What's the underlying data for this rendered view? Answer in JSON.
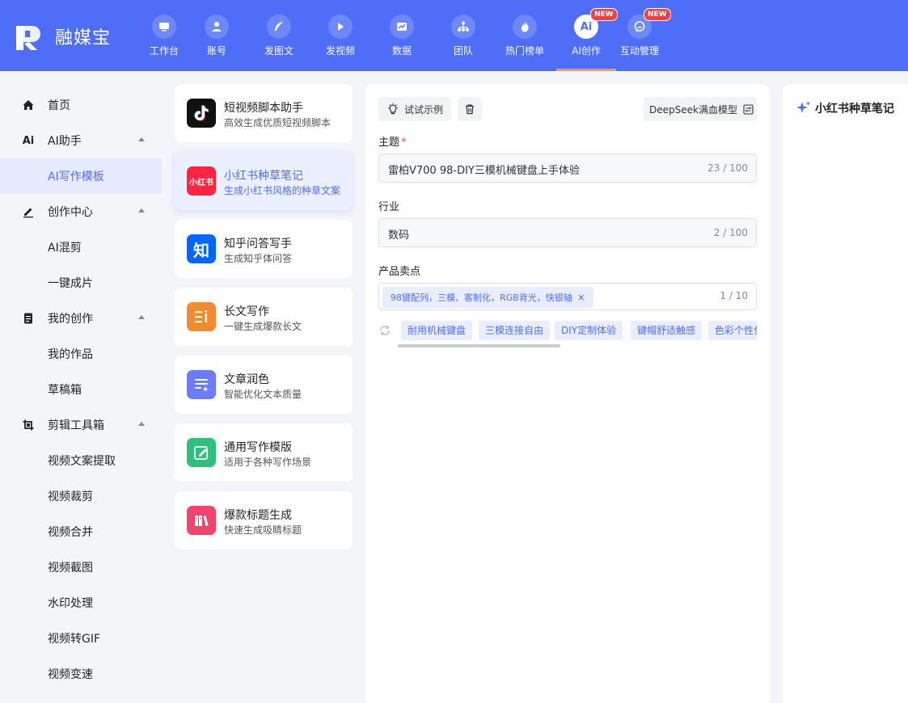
{
  "app": {
    "brand": "融媒宝"
  },
  "nav": {
    "items": [
      {
        "label": "工作台",
        "icon": "monitor-icon"
      },
      {
        "label": "账号",
        "icon": "user-icon"
      },
      {
        "label": "发图文",
        "icon": "feather-icon"
      },
      {
        "label": "发视频",
        "icon": "play-icon"
      },
      {
        "label": "数据",
        "icon": "chart-icon"
      },
      {
        "label": "团队",
        "icon": "org-icon"
      },
      {
        "label": "热门榜单",
        "icon": "flame-icon"
      },
      {
        "label": "AI创作",
        "icon": "ai-icon",
        "badge": "NEW",
        "active": true
      },
      {
        "label": "互动管理",
        "icon": "chat-icon",
        "badge": "NEW"
      }
    ],
    "ai_icon_text": "Ai",
    "badge_text": "NEW"
  },
  "sidebar": {
    "groups": [
      {
        "label": "首页",
        "icon": "home-icon"
      },
      {
        "label": "AI助手",
        "icon": "ai-text-icon",
        "icon_text": "Ai",
        "children": [
          "AI写作模板"
        ]
      },
      {
        "label": "创作中心",
        "icon": "pencil-icon",
        "children": [
          "AI混剪",
          "一键成片"
        ]
      },
      {
        "label": "我的创作",
        "icon": "doc-icon",
        "children": [
          "我的作品",
          "草稿箱"
        ]
      },
      {
        "label": "剪辑工具箱",
        "icon": "crop-icon",
        "children": [
          "视频文案提取",
          "视频裁剪",
          "视频合并",
          "视频截图",
          "水印处理",
          "视频转GIF",
          "视频变速"
        ]
      }
    ],
    "active_item": "AI写作模板"
  },
  "templates": [
    {
      "title": "短视频脚本助手",
      "desc": "高效生成优质短视频脚本",
      "icon": "tiktok-icon",
      "color": "#111111"
    },
    {
      "title": "小红书种草笔记",
      "desc": "生成小红书风格的种草文案",
      "icon": "xiaohongshu-icon",
      "icon_text": "小红书",
      "color": "#ff2442",
      "active": true
    },
    {
      "title": "知乎问答写手",
      "desc": "生成知乎体问答",
      "icon": "zhihu-icon",
      "icon_text": "知",
      "color": "#0066ff"
    },
    {
      "title": "长文写作",
      "desc": "一键生成爆款长文",
      "icon": "longtext-icon",
      "color": "#f28b30"
    },
    {
      "title": "文章润色",
      "desc": "智能优化文本质量",
      "icon": "polish-icon",
      "color": "#6b7cff"
    },
    {
      "title": "通用写作模版",
      "desc": "适用于各种写作场景",
      "icon": "edit-icon",
      "color": "#2ec17c"
    },
    {
      "title": "爆款标题生成",
      "desc": "快速生成吸睛标题",
      "icon": "books-icon",
      "color": "#f0446c"
    }
  ],
  "form": {
    "try_example": "试试示例",
    "model": "DeepSeek满血模型",
    "topic": {
      "label": "主题",
      "required_mark": "*",
      "value": "雷柏V700 98-DIY三模机械键盘上手体验",
      "count": "23 / 100"
    },
    "industry": {
      "label": "行业",
      "value": "数码",
      "count": "2 / 100"
    },
    "selling_points": {
      "label": "产品卖点",
      "tags": [
        "98键配列，三模、客制化，RGB背光，快银轴"
      ],
      "count": "1 / 10",
      "suggestions": [
        "耐用机械键盘",
        "三模连接自由",
        "DIY定制体验",
        "键帽舒适触感",
        "色彩个性化"
      ]
    }
  },
  "output": {
    "title": "小红书种草笔记"
  },
  "colors": {
    "primary": "#4f6ef7",
    "nav_active_underline": "#ff9a3c",
    "badge": "#f53f3f"
  }
}
